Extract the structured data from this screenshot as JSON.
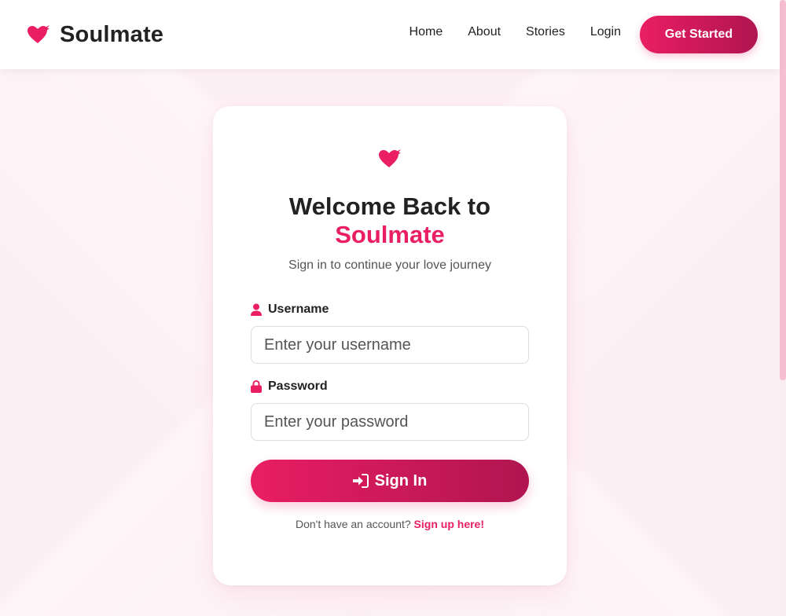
{
  "header": {
    "brand_name": "Soulmate",
    "brand_icon": "winged-heart-icon",
    "nav": [
      {
        "label": "Home"
      },
      {
        "label": "About"
      },
      {
        "label": "Stories"
      },
      {
        "label": "Login"
      }
    ],
    "cta_label": "Get Started"
  },
  "card": {
    "icon": "winged-heart-icon",
    "title": "Welcome Back to",
    "title_accent": "Soulmate",
    "subtitle": "Sign in to continue your love journey",
    "username": {
      "label": "Username",
      "icon": "user-icon",
      "value": "",
      "placeholder": "Enter your username"
    },
    "password": {
      "label": "Password",
      "icon": "lock-icon",
      "value": "",
      "placeholder": "Enter your password"
    },
    "signin_label": "Sign In",
    "signin_icon": "sign-in-icon",
    "footer_text": "Don't have an account?",
    "signup_link": "Sign up here!"
  },
  "colors": {
    "accent": "#e91e63",
    "accent_dark": "#b0154f",
    "background": "#fdf0f4",
    "text": "#222222",
    "muted": "#555555"
  }
}
